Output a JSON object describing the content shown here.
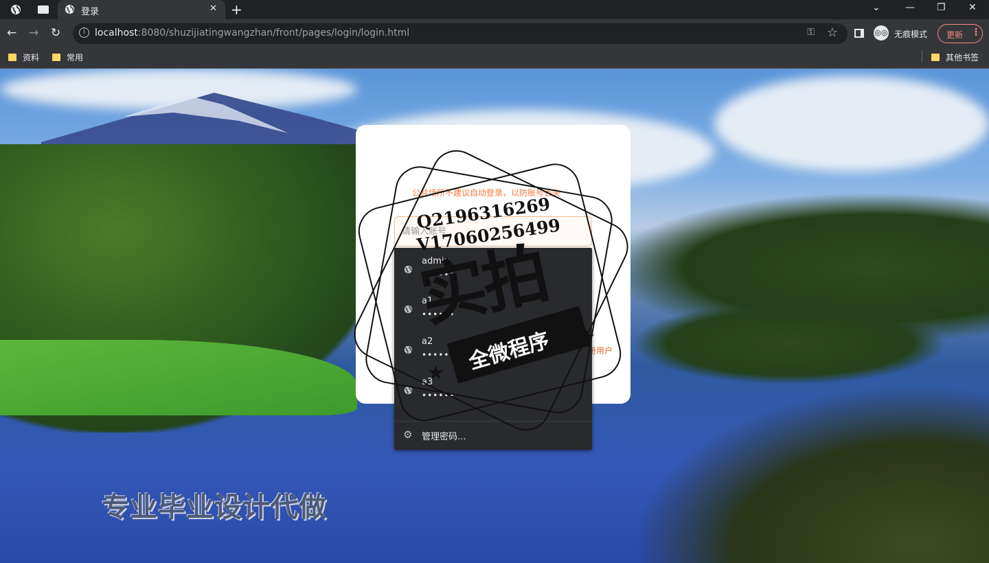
{
  "tab": {
    "title": "登录",
    "close": "✕",
    "new_tab": "+"
  },
  "window_controls": {
    "dropdown": "⌄",
    "minimize": "—",
    "restore": "❐",
    "close": "✕"
  },
  "toolbar": {
    "url_host": "localhost",
    "url_rest": ":8080/shuzijiatingwangzhan/front/pages/login/login.html",
    "incognito_label": "无痕模式",
    "update_label": "更新"
  },
  "bookmarks": {
    "items": [
      "资料",
      "常用"
    ],
    "other": "其他书签"
  },
  "login": {
    "notice": "公共场所不建议自动登录，以防账号丢失",
    "username_placeholder": "请输入账号",
    "register_link": "册用户"
  },
  "autofill": {
    "entries": [
      {
        "user": "admin",
        "password": "••••••"
      },
      {
        "user": "a1",
        "password": "••••••"
      },
      {
        "user": "a2",
        "password": "••••••"
      },
      {
        "user": "a3",
        "password": "••••••"
      }
    ],
    "manage_label": "管理密码..."
  },
  "watermark": {
    "line1": "Q2196316269",
    "line2": "V17060256499",
    "big": "实拍",
    "ribbon": "全微程序",
    "bottom": "专业毕业设计代做"
  },
  "colors": {
    "accent": "#f5793a",
    "chrome_dark": "#202124",
    "chrome": "#35363a",
    "dropdown": "#292a2d"
  }
}
